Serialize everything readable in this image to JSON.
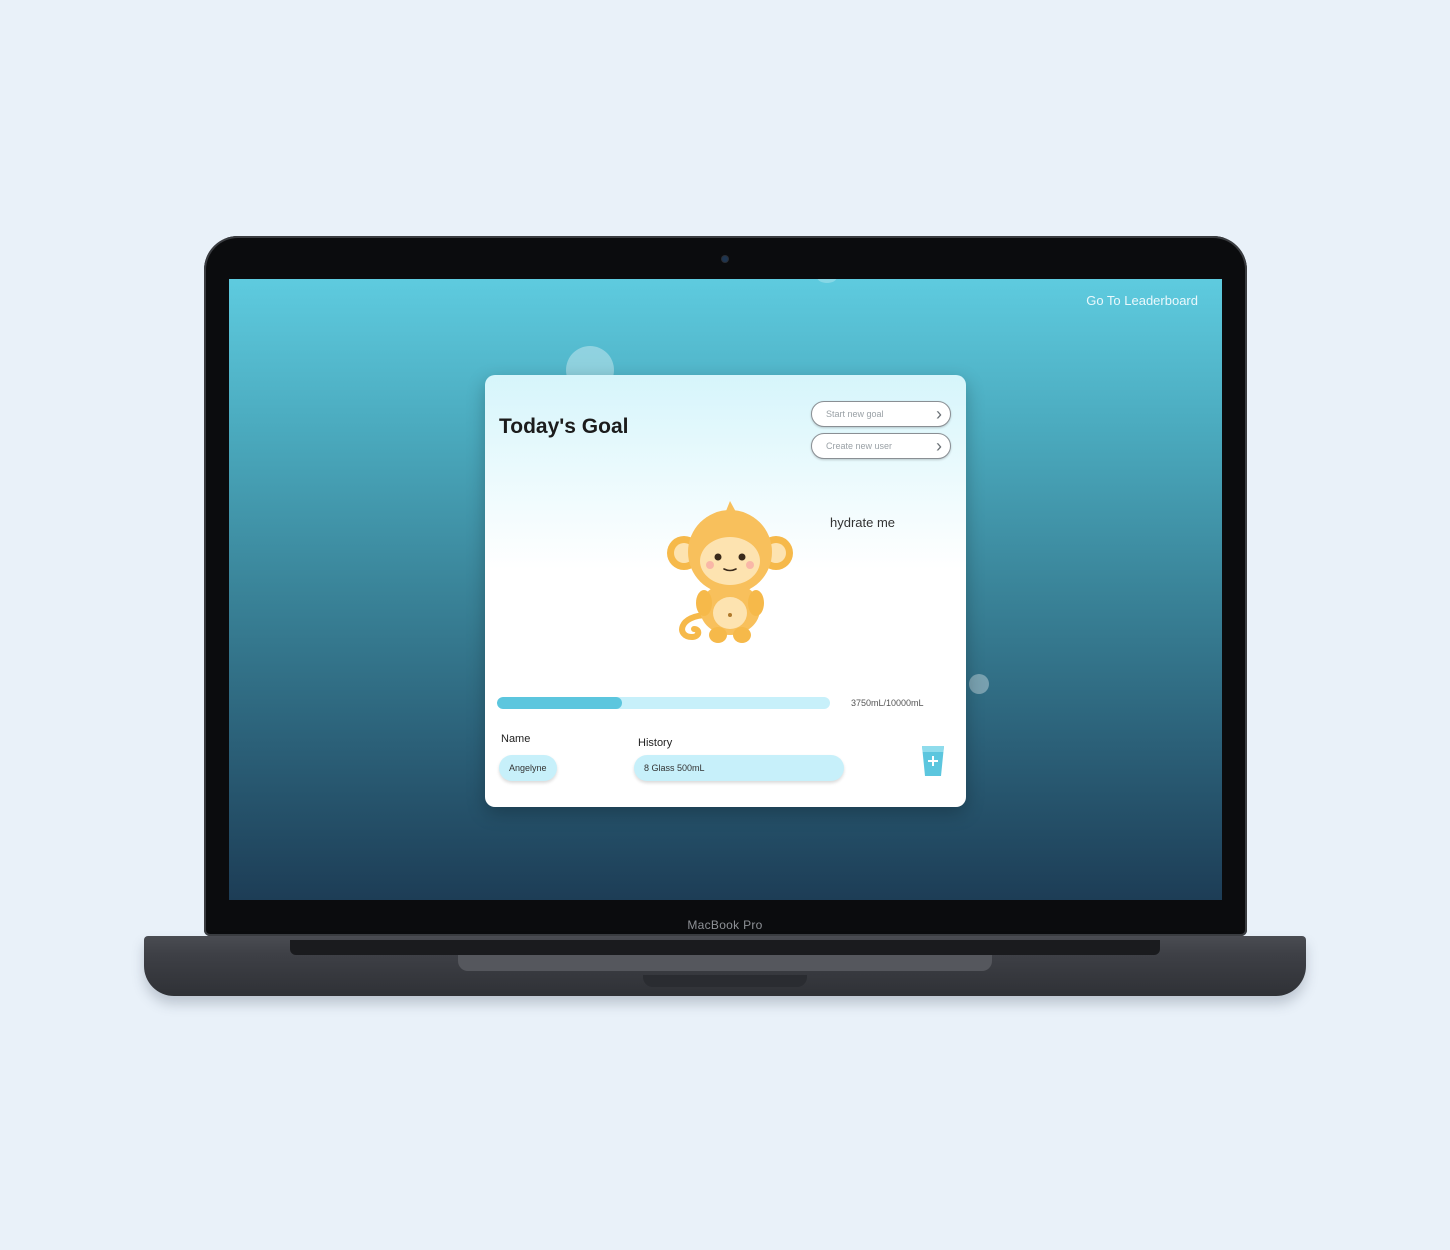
{
  "device": {
    "label": "MacBook Pro"
  },
  "nav": {
    "leaderboard_link": "Go To Leaderboard"
  },
  "card": {
    "title": "Today's Goal",
    "buttons": {
      "start_goal": "Start new goal",
      "create_user": "Create new user"
    },
    "speech": "hydrate me",
    "mascot": "monkey"
  },
  "progress": {
    "text": "3750mL/10000mL",
    "current_ml": 3750,
    "goal_ml": 10000
  },
  "user": {
    "name_label": "Name",
    "name_value": "Angelyne"
  },
  "history": {
    "label": "History",
    "value": "8 Glass 500mL"
  },
  "icons": {
    "add": "add-water-glass-icon",
    "chevron": "chevron-right-icon"
  },
  "colors": {
    "accent": "#5cc6de",
    "track": "#c7f0fa",
    "screen_top": "#5ecbdf",
    "screen_bottom": "#1d3d56"
  }
}
